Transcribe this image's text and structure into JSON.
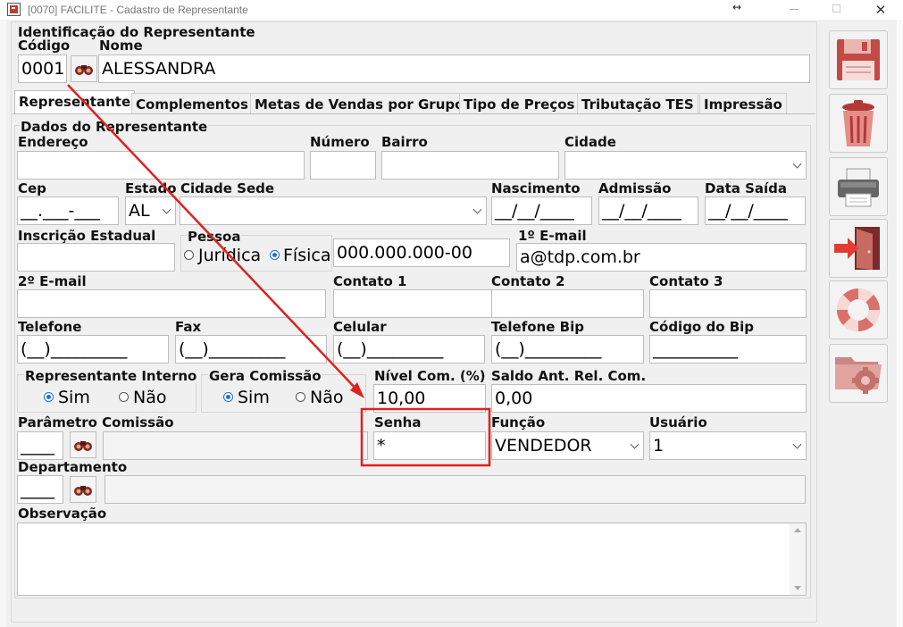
{
  "window": {
    "title": "[0070] FACILITE - Cadastro de Representante"
  },
  "header": {
    "section_title": "Identificação do Representante",
    "codigo_label": "Código",
    "codigo_value": "0001",
    "nome_label": "Nome",
    "nome_value": "ALESSANDRA"
  },
  "tabs": [
    {
      "label": "Representante"
    },
    {
      "label": "Complementos"
    },
    {
      "label": "Metas de Vendas por Grupo"
    },
    {
      "label": "Tipo de Preços"
    },
    {
      "label": "Tributação TES"
    },
    {
      "label": "Impressão"
    }
  ],
  "form": {
    "group_title": "Dados do Representante",
    "endereco_label": "Endereço",
    "endereco_value": "",
    "numero_label": "Número",
    "numero_value": "",
    "bairro_label": "Bairro",
    "bairro_value": "",
    "cidade_label": "Cidade",
    "cidade_value": "",
    "cep_label": "Cep",
    "cep_value": "__.___-___",
    "estado_label": "Estado",
    "estado_value": "AL",
    "cidade_sede_label": "Cidade Sede",
    "cidade_sede_value": "",
    "nascimento_label": "Nascimento",
    "nascimento_value": "__/__/____",
    "admissao_label": "Admissão",
    "admissao_value": "__/__/____",
    "data_saida_label": "Data Saída",
    "data_saida_value": "__/__/____",
    "inscricao_label": "Inscrição Estadual",
    "inscricao_value": "",
    "pessoa_label": "Pessoa",
    "pessoa_juridica": "Jurídica",
    "pessoa_fisica": "Física",
    "cpf_value": "000.000.000-00",
    "email1_label": "1º E-mail",
    "email1_value": "a@tdp.com.br",
    "email2_label": "2º E-mail",
    "email2_value": "",
    "contato1_label": "Contato 1",
    "contato1_value": "",
    "contato2_label": "Contato 2",
    "contato2_value": "",
    "contato3_label": "Contato 3",
    "contato3_value": "",
    "telefone_label": "Telefone",
    "telefone_value": "(__)_________",
    "fax_label": "Fax",
    "fax_value": "(__)_________",
    "celular_label": "Celular",
    "celular_value": "(__)_________",
    "telefone_bip_label": "Telefone Bip",
    "telefone_bip_value": "(__)_________",
    "codigo_bip_label": "Código do Bip",
    "codigo_bip_value": "__________",
    "rep_interno_label": "Representante Interno",
    "rep_interno_sim": "Sim",
    "rep_interno_nao": "Não",
    "gera_comissao_label": "Gera Comissão",
    "gera_comissao_sim": "Sim",
    "gera_comissao_nao": "Não",
    "nivel_com_label": "Nível Com. (%)",
    "nivel_com_value": "10,00",
    "saldo_label": "Saldo Ant. Rel. Com.",
    "saldo_value": "0,00",
    "param_comissao_label": "Parâmetro Comissão",
    "param_comissao_value": "____",
    "senha_label": "Senha",
    "senha_value": "*",
    "funcao_label": "Função",
    "funcao_value": "VENDEDOR",
    "usuario_label": "Usuário",
    "usuario_value": "1",
    "departamento_label": "Departamento",
    "departamento_value": "____",
    "observacao_label": "Observação",
    "observacao_value": ""
  },
  "sidebar": {
    "buttons": [
      "save-icon",
      "trash-icon",
      "printer-icon",
      "exit-door-icon",
      "lifebuoy-icon",
      "folder-settings-icon"
    ]
  },
  "annotation": {
    "highlight_color": "#e02020"
  }
}
